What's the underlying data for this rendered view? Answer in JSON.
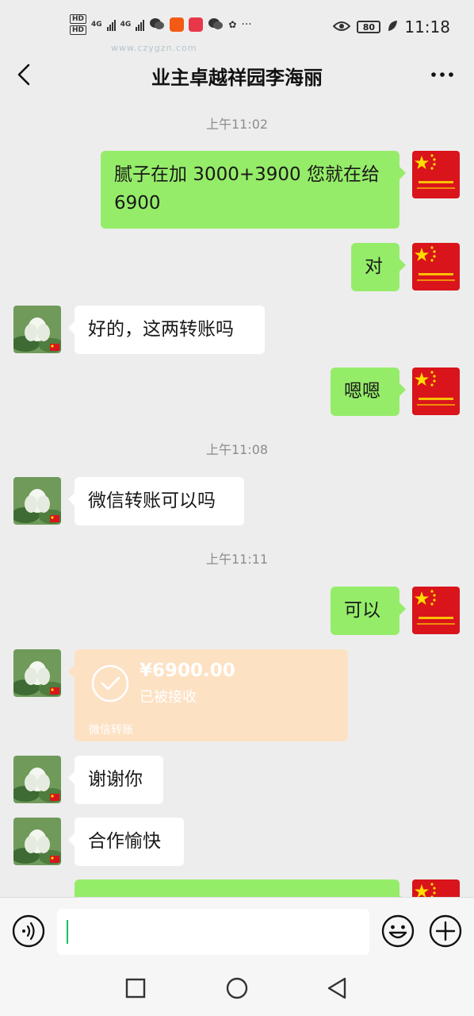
{
  "status_bar": {
    "hd_1": "HD",
    "hd_2": "HD",
    "net_1": "4G",
    "net_2": "4G",
    "dots": "···",
    "battery": "80",
    "time": "11:18",
    "watermark": "www.czygzn.com"
  },
  "header": {
    "title": "业主卓越祥园李海丽"
  },
  "messages": [
    {
      "type": "time",
      "text": "上午11:02"
    },
    {
      "type": "sent",
      "text": "腻子在加 3000+3900 您就在给6900"
    },
    {
      "type": "sent",
      "text": "对"
    },
    {
      "type": "received",
      "text": "好的，这两转账吗"
    },
    {
      "type": "sent",
      "text": "嗯嗯"
    },
    {
      "type": "time",
      "text": "上午11:08"
    },
    {
      "type": "received",
      "text": "微信转账可以吗"
    },
    {
      "type": "time",
      "text": "上午11:11"
    },
    {
      "type": "sent",
      "text": "可以"
    },
    {
      "type": "transfer",
      "amount": "¥6900.00",
      "status": "已被接收",
      "label": "微信转账"
    },
    {
      "type": "received",
      "text": "谢谢你"
    },
    {
      "type": "received",
      "text": "合作愉快"
    }
  ],
  "colors": {
    "sent_bubble": "#95ec69",
    "received_bubble": "#ffffff",
    "transfer_card": "#fde1c3",
    "background": "#ededed"
  },
  "input": {
    "value": "",
    "placeholder": ""
  },
  "icons": {
    "back": "chevron-left-icon",
    "more": "more-dots-icon",
    "voice": "voice-icon",
    "emoji": "emoji-icon",
    "plus": "plus-icon"
  }
}
